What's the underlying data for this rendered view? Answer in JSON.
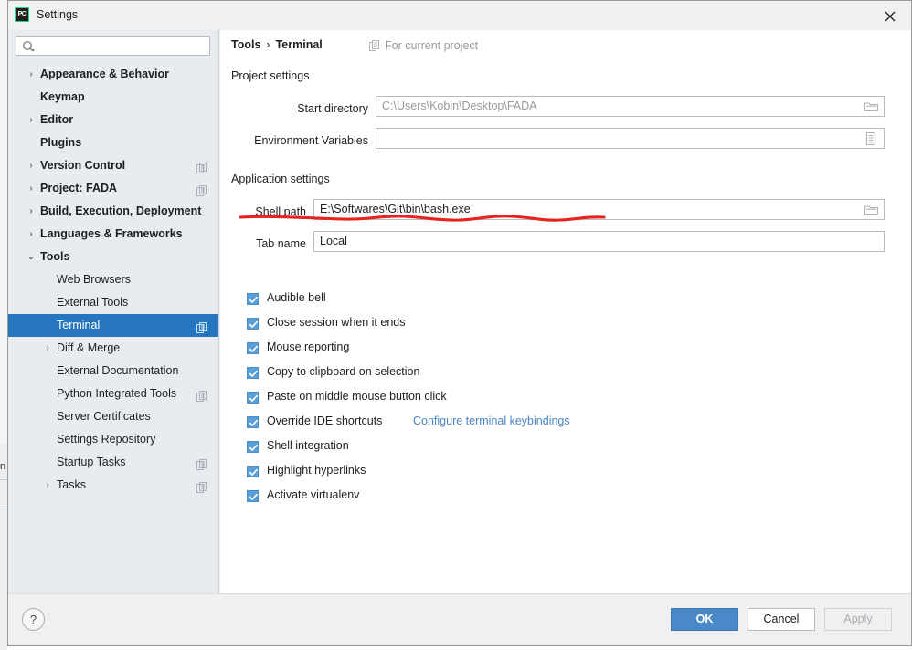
{
  "window": {
    "title": "Settings",
    "app_icon": "pycharm-icon",
    "close_icon": "close-icon"
  },
  "search": {
    "value": "",
    "placeholder": "",
    "icon": "search-icon"
  },
  "sidebar": {
    "items": [
      {
        "label": "Appearance & Behavior",
        "depth": 0,
        "chevron": "›",
        "bold": true,
        "scope_icon": false,
        "selected": false
      },
      {
        "label": "Keymap",
        "depth": 0,
        "chevron": "",
        "bold": true,
        "scope_icon": false,
        "selected": false
      },
      {
        "label": "Editor",
        "depth": 0,
        "chevron": "›",
        "bold": true,
        "scope_icon": false,
        "selected": false
      },
      {
        "label": "Plugins",
        "depth": 0,
        "chevron": "",
        "bold": true,
        "scope_icon": false,
        "selected": false
      },
      {
        "label": "Version Control",
        "depth": 0,
        "chevron": "›",
        "bold": true,
        "scope_icon": true,
        "selected": false
      },
      {
        "label": "Project: FADA",
        "depth": 0,
        "chevron": "›",
        "bold": true,
        "scope_icon": true,
        "selected": false
      },
      {
        "label": "Build, Execution, Deployment",
        "depth": 0,
        "chevron": "›",
        "bold": true,
        "scope_icon": false,
        "selected": false
      },
      {
        "label": "Languages & Frameworks",
        "depth": 0,
        "chevron": "›",
        "bold": true,
        "scope_icon": false,
        "selected": false
      },
      {
        "label": "Tools",
        "depth": 0,
        "chevron": "⌄",
        "bold": true,
        "scope_icon": false,
        "selected": false
      },
      {
        "label": "Web Browsers",
        "depth": 1,
        "chevron": "",
        "bold": false,
        "scope_icon": false,
        "selected": false
      },
      {
        "label": "External Tools",
        "depth": 1,
        "chevron": "",
        "bold": false,
        "scope_icon": false,
        "selected": false
      },
      {
        "label": "Terminal",
        "depth": 1,
        "chevron": "",
        "bold": false,
        "scope_icon": true,
        "selected": true
      },
      {
        "label": "Diff & Merge",
        "depth": 1,
        "chevron": "›",
        "bold": false,
        "scope_icon": false,
        "selected": false
      },
      {
        "label": "External Documentation",
        "depth": 1,
        "chevron": "",
        "bold": false,
        "scope_icon": false,
        "selected": false
      },
      {
        "label": "Python Integrated Tools",
        "depth": 1,
        "chevron": "",
        "bold": false,
        "scope_icon": true,
        "selected": false
      },
      {
        "label": "Server Certificates",
        "depth": 1,
        "chevron": "",
        "bold": false,
        "scope_icon": false,
        "selected": false
      },
      {
        "label": "Settings Repository",
        "depth": 1,
        "chevron": "",
        "bold": false,
        "scope_icon": false,
        "selected": false
      },
      {
        "label": "Startup Tasks",
        "depth": 1,
        "chevron": "",
        "bold": false,
        "scope_icon": true,
        "selected": false
      },
      {
        "label": "Tasks",
        "depth": 1,
        "chevron": "›",
        "bold": false,
        "scope_icon": true,
        "selected": false
      }
    ]
  },
  "content": {
    "breadcrumb": {
      "parent": "Tools",
      "separator": "›",
      "current": "Terminal"
    },
    "scope_note": {
      "text": "For current project",
      "icon": "project-scope-icon"
    },
    "project_settings": {
      "title": "Project settings",
      "start_directory": {
        "label": "Start directory",
        "value": "C:\\Users\\Kobin\\Desktop\\FADA",
        "is_placeholder": true,
        "button_icon": "folder-icon"
      },
      "environment_variables": {
        "label": "Environment Variables",
        "value": "",
        "is_placeholder": false,
        "button_icon": "list-icon"
      }
    },
    "application_settings": {
      "title": "Application settings",
      "shell_path": {
        "label": "Shell path",
        "value": "E:\\Softwares\\Git\\bin\\bash.exe",
        "is_placeholder": false,
        "button_icon": "folder-icon"
      },
      "tab_name": {
        "label": "Tab name",
        "value": "Local",
        "is_placeholder": false
      },
      "checkboxes": [
        {
          "label": "Audible bell",
          "checked": true,
          "link": null
        },
        {
          "label": "Close session when it ends",
          "checked": true,
          "link": null
        },
        {
          "label": "Mouse reporting",
          "checked": true,
          "link": null
        },
        {
          "label": "Copy to clipboard on selection",
          "checked": true,
          "link": null
        },
        {
          "label": "Paste on middle mouse button click",
          "checked": true,
          "link": null
        },
        {
          "label": "Override IDE shortcuts",
          "checked": true,
          "link": "Configure terminal keybindings"
        },
        {
          "label": "Shell integration",
          "checked": true,
          "link": null
        },
        {
          "label": "Highlight hyperlinks",
          "checked": true,
          "link": null
        },
        {
          "label": "Activate virtualenv",
          "checked": true,
          "link": null
        }
      ]
    }
  },
  "annotation": {
    "type": "red-underline",
    "color": "#e8221c",
    "target": "shell_path"
  },
  "footer": {
    "help_label": "?",
    "ok_label": "OK",
    "cancel_label": "Cancel",
    "apply_label": "Apply",
    "apply_disabled": true
  },
  "colors": {
    "selection_blue": "#2675bf",
    "primary_button": "#4a89c8",
    "checkbox_blue": "#5a9fd8",
    "link_blue": "#4a86c5",
    "sidebar_bg": "#e8ecf0",
    "annotation_red": "#e8221c"
  }
}
